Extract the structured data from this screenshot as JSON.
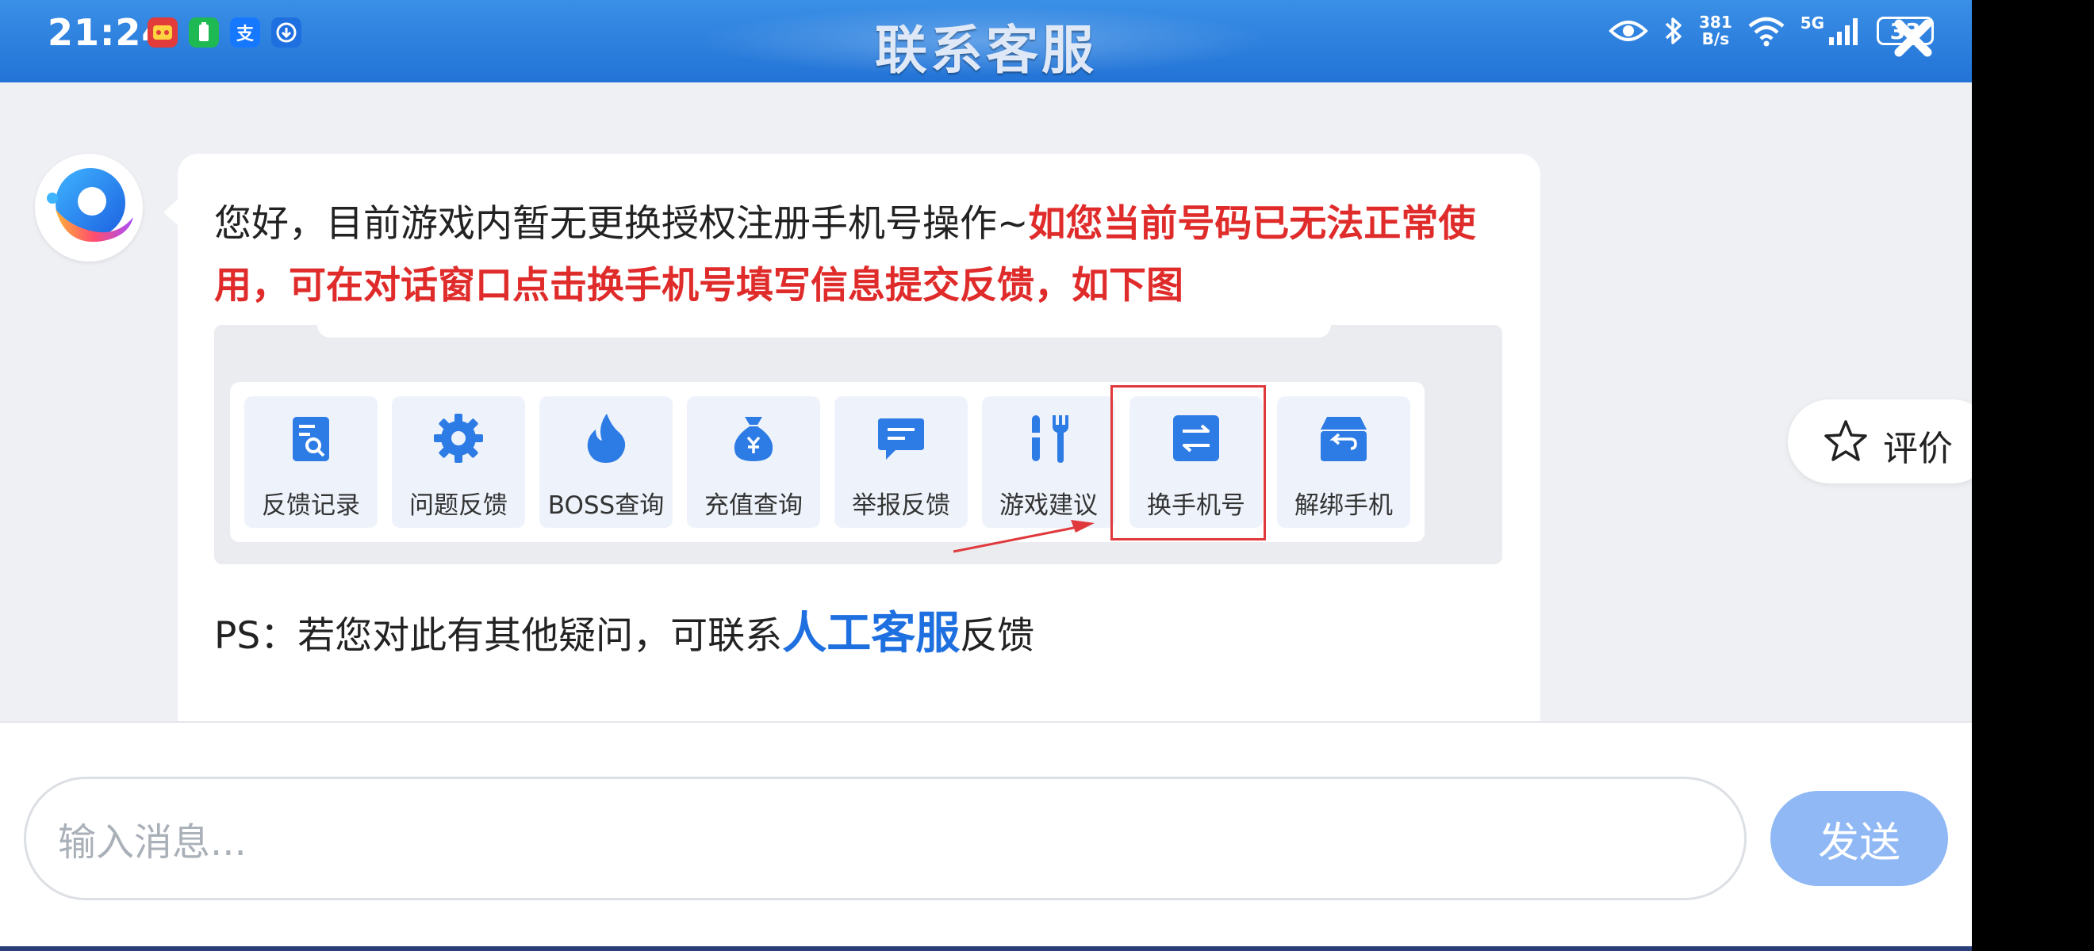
{
  "status_bar": {
    "time": "21:24",
    "app_icons": [
      {
        "name": "game-center-app-icon",
        "glyph": "",
        "color": "#e23b3b"
      },
      {
        "name": "battery-app-icon",
        "glyph": "",
        "color": "#1fb954"
      },
      {
        "name": "alipay-app-icon",
        "glyph": "支",
        "color": "#1677ff"
      },
      {
        "name": "download-app-icon",
        "glyph": "",
        "color": "#1e6fe0"
      }
    ],
    "net_speed_value": "381",
    "net_speed_unit": "B/s",
    "signal_label": "5G",
    "battery_level": "33"
  },
  "header": {
    "title": "联系客服"
  },
  "message": {
    "text_plain": "您好，目前游戏内暂无更换授权注册手机号操作~",
    "text_highlight": "如您当前号码已无法正常使用，可在对话窗口点击换手机号填写信息提交反馈，如下图",
    "ps_prefix": "PS：若您对此有其他疑问，可联系",
    "ps_link": "人工客服",
    "ps_suffix": "反馈"
  },
  "tool_panel": {
    "items": [
      {
        "label": "反馈记录",
        "icon": "feedback-record-icon"
      },
      {
        "label": "问题反馈",
        "icon": "gear-icon"
      },
      {
        "label": "BOSS查询",
        "icon": "flame-icon"
      },
      {
        "label": "充值查询",
        "icon": "money-bag-icon"
      },
      {
        "label": "举报反馈",
        "icon": "chat-bubble-icon"
      },
      {
        "label": "游戏建议",
        "icon": "tools-icon"
      },
      {
        "label": "换手机号",
        "icon": "swap-icon"
      },
      {
        "label": "解绑手机",
        "icon": "inbox-return-icon"
      }
    ],
    "highlighted_item": "换手机号",
    "icon_color": "#2d7be5",
    "highlight_color": "#e0393c"
  },
  "rating": {
    "label": "评价"
  },
  "input": {
    "placeholder": "输入消息...",
    "send_label": "发送"
  },
  "colors": {
    "header": "#2a7fe0",
    "accent_red": "#e02b2b",
    "link_blue": "#1e6fe0",
    "send_button": "#8fb8f5"
  }
}
